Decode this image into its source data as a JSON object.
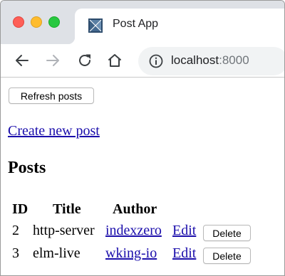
{
  "browser": {
    "tab_title": "Post App",
    "url_host": "localhost",
    "url_port": ":8000"
  },
  "page": {
    "refresh_label": "Refresh posts",
    "create_link": "Create new post",
    "heading": "Posts",
    "table": {
      "headers": {
        "id": "ID",
        "title": "Title",
        "author": "Author"
      },
      "rows": [
        {
          "id": "2",
          "title": "http-server",
          "author": "indexzero",
          "edit": "Edit",
          "delete": "Delete"
        },
        {
          "id": "3",
          "title": "elm-live",
          "author": "wking-io",
          "edit": "Edit",
          "delete": "Delete"
        }
      ]
    }
  },
  "colors": {
    "link": "#1a0dab",
    "tabstrip": "#dee1e6",
    "omnibox": "#f1f3f4"
  },
  "icons": [
    "back-arrow-icon",
    "forward-arrow-icon",
    "reload-icon",
    "home-icon",
    "info-icon",
    "favicon-icon"
  ]
}
